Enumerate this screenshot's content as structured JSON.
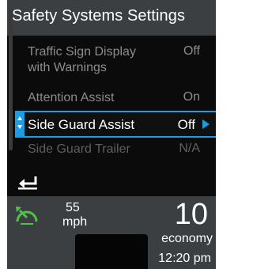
{
  "header": {
    "title": "Safety Systems Settings"
  },
  "menu": {
    "items": [
      {
        "label": "Traffic Sign Display\nwith Warnings",
        "value": "Off"
      },
      {
        "label": "Attention Assist",
        "value": "On"
      },
      {
        "label": "Side Guard Assist",
        "value": "Off"
      },
      {
        "label": "Side Guard Trailer",
        "value": "N/A"
      }
    ]
  },
  "footer": {
    "speed": "55",
    "speed_unit": "mph",
    "gear_number": "10",
    "mode": "economy",
    "time": "12:20 pm"
  },
  "colors": {
    "accent": "#1f9be0",
    "speed_icon": "#4fc24a",
    "header_bg": "#3b3f42"
  },
  "icons": {
    "back": "back-arrow-icon",
    "speed": "speed-limit-icon"
  }
}
